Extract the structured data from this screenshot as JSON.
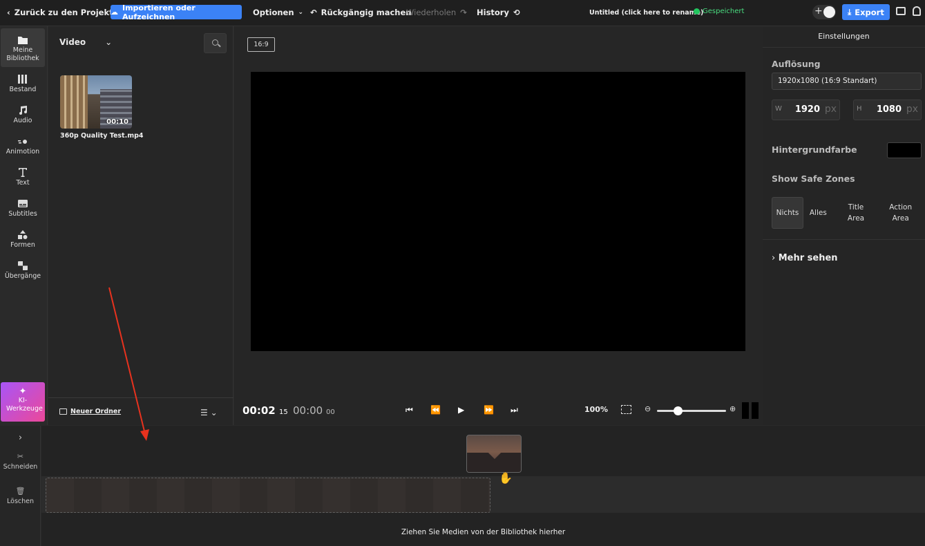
{
  "topbar": {
    "back_label": "Zurück zu den Projekten",
    "import_label": "Importieren oder Aufzeichnen",
    "options_label": "Optionen",
    "undo_label": "Rückgängig machen",
    "redo_label": "Wiederholen",
    "history_label": "History",
    "project_title": "Untitled (click here to rename)",
    "saved_label": "Gespeichert",
    "export_label": "Export"
  },
  "nav": {
    "items": [
      {
        "label": "Meine Bibliothek",
        "icon": "folder-icon"
      },
      {
        "label": "Bestand",
        "icon": "stock-icon"
      },
      {
        "label": "Audio",
        "icon": "music-note-icon"
      },
      {
        "label": "Animotion",
        "icon": "animation-icon"
      },
      {
        "label": "Text",
        "icon": "text-icon"
      },
      {
        "label": "Subtitles",
        "icon": "subtitles-icon"
      },
      {
        "label": "Formen",
        "icon": "shapes-icon"
      },
      {
        "label": "Übergänge",
        "icon": "transitions-icon"
      }
    ],
    "ki_label": "KI-Werkzeuge"
  },
  "library": {
    "filter_label": "Video",
    "media": [
      {
        "name": "360p Quality Test.mp4",
        "duration": "00:10"
      }
    ],
    "new_folder_label": "Neuer Ordner"
  },
  "preview": {
    "aspect_ratio": "16:9",
    "current_time": "00:02",
    "current_frames": "15",
    "total_time": "00:00",
    "total_frames": "00",
    "zoom": "100%",
    "zoom_level": 0.3
  },
  "settings": {
    "title": "Einstellungen",
    "resolution_label": "Auflösung",
    "resolution_value": "1920x1080 (16:9 Standart)",
    "width_key": "W",
    "width_value": "1920",
    "height_key": "H",
    "height_value": "1080",
    "unit": "px",
    "bg_label": "Hintergrundfarbe",
    "bg_color": "#000000",
    "safe_zones_label": "Show Safe Zones",
    "zones": [
      "Nichts",
      "Alles",
      "Title Area",
      "Action Area"
    ],
    "more_label": "Mehr sehen"
  },
  "timeline": {
    "cut_label": "Schneiden",
    "delete_label": "Löschen",
    "drop_hint": "Ziehen Sie Medien von der Bibliothek hierher"
  },
  "colors": {
    "accent": "#3b82f6",
    "saved": "#22c55e",
    "annotation": "#e8321e"
  }
}
